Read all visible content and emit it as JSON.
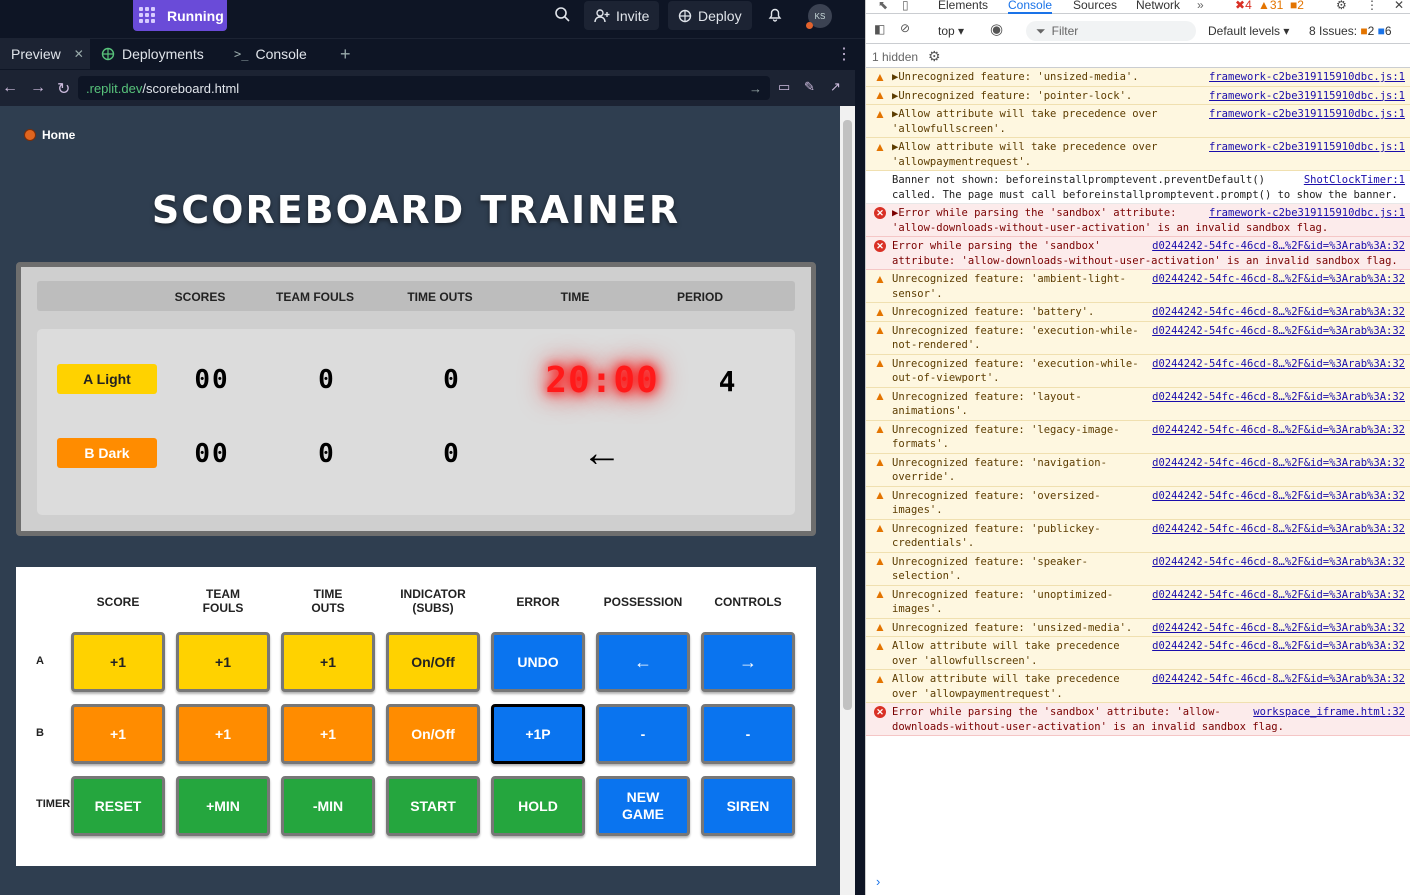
{
  "topbar": {
    "run_label": "Running",
    "invite_label": "Invite",
    "deploy_label": "Deploy",
    "avatar_initials": "KS"
  },
  "tabs": [
    {
      "label": "Preview"
    },
    {
      "label": "Deployments"
    },
    {
      "label": "Console"
    }
  ],
  "url": {
    "domain": ".replit.dev",
    "path": "/scoreboard.html"
  },
  "page": {
    "home_label": "Home",
    "title": "SCOREBOARD TRAINER"
  },
  "scoreboard": {
    "headers": [
      "SCORES",
      "TEAM FOULS",
      "TIME OUTS",
      "TIME",
      "PERIOD"
    ],
    "team_a": {
      "name": "A Light",
      "score": "00",
      "fouls": "0",
      "timeouts": "0"
    },
    "team_b": {
      "name": "B Dark",
      "score": "00",
      "fouls": "0",
      "timeouts": "0"
    },
    "time": "20:00",
    "period": "4",
    "possession_arrow": "←"
  },
  "controls": {
    "headers": [
      "SCORE",
      "TEAM\nFOULS",
      "TIME\nOUTS",
      "INDICATOR\n(SUBS)",
      "ERROR",
      "POSSESSION",
      "CONTROLS"
    ],
    "rows": [
      {
        "label": "A",
        "buttons": [
          "+1",
          "+1",
          "+1",
          "On/Off",
          "UNDO",
          "←",
          "→"
        ]
      },
      {
        "label": "B",
        "buttons": [
          "+1",
          "+1",
          "+1",
          "On/Off",
          "+1P",
          "-",
          "-"
        ]
      },
      {
        "label": "TIMER",
        "buttons": [
          "RESET",
          "+MIN",
          "-MIN",
          "START",
          "HOLD",
          "NEW\nGAME",
          "SIREN"
        ]
      }
    ]
  },
  "devtools": {
    "tabs": [
      "Elements",
      "Console",
      "Sources",
      "Network"
    ],
    "badges": {
      "errors": "4",
      "warnings": "31",
      "info": "2"
    },
    "context": "top",
    "filter_placeholder": "Filter",
    "levels": "Default levels",
    "issues": "8 Issues:",
    "issues_warn": "2",
    "issues_info": "6",
    "hidden": "1 hidden",
    "logs": [
      {
        "level": "warn",
        "msg": "▶Unrecognized feature: 'unsized-media'.",
        "src": "framework-c2be319115910dbc.js:1"
      },
      {
        "level": "warn",
        "msg": "▶Unrecognized feature: 'pointer-lock'.",
        "src": "framework-c2be319115910dbc.js:1"
      },
      {
        "level": "warn",
        "msg": "▶Allow attribute will take precedence over 'allowfullscreen'.",
        "src": "framework-c2be319115910dbc.js:1"
      },
      {
        "level": "warn",
        "msg": "▶Allow attribute will take precedence over 'allowpaymentrequest'.",
        "src": "framework-c2be319115910dbc.js:1"
      },
      {
        "level": "info",
        "msg": "Banner not shown: beforeinstallpromptevent.preventDefault() called. The page must call beforeinstallpromptevent.prompt() to show the banner.",
        "src": "ShotClockTimer:1"
      },
      {
        "level": "err",
        "msg": "▶Error while parsing the 'sandbox' attribute: 'allow-downloads-without-user-activation' is an invalid sandbox flag.",
        "src": "framework-c2be319115910dbc.js:1"
      },
      {
        "level": "err",
        "msg": "Error while parsing the 'sandbox' attribute: 'allow-downloads-without-user-activation' is an invalid sandbox flag.",
        "src": "d0244242-54fc-46cd-8…%2F&id=%3Arab%3A:32"
      },
      {
        "level": "warn",
        "msg": "Unrecognized feature: 'ambient-light-sensor'.",
        "src": "d0244242-54fc-46cd-8…%2F&id=%3Arab%3A:32"
      },
      {
        "level": "warn",
        "msg": "Unrecognized feature: 'battery'.",
        "src": "d0244242-54fc-46cd-8…%2F&id=%3Arab%3A:32"
      },
      {
        "level": "warn",
        "msg": "Unrecognized feature: 'execution-while-not-rendered'.",
        "src": "d0244242-54fc-46cd-8…%2F&id=%3Arab%3A:32"
      },
      {
        "level": "warn",
        "msg": "Unrecognized feature: 'execution-while-out-of-viewport'.",
        "src": "d0244242-54fc-46cd-8…%2F&id=%3Arab%3A:32"
      },
      {
        "level": "warn",
        "msg": "Unrecognized feature: 'layout-animations'.",
        "src": "d0244242-54fc-46cd-8…%2F&id=%3Arab%3A:32"
      },
      {
        "level": "warn",
        "msg": "Unrecognized feature: 'legacy-image-formats'.",
        "src": "d0244242-54fc-46cd-8…%2F&id=%3Arab%3A:32"
      },
      {
        "level": "warn",
        "msg": "Unrecognized feature: 'navigation-override'.",
        "src": "d0244242-54fc-46cd-8…%2F&id=%3Arab%3A:32"
      },
      {
        "level": "warn",
        "msg": "Unrecognized feature: 'oversized-images'.",
        "src": "d0244242-54fc-46cd-8…%2F&id=%3Arab%3A:32"
      },
      {
        "level": "warn",
        "msg": "Unrecognized feature: 'publickey-credentials'.",
        "src": "d0244242-54fc-46cd-8…%2F&id=%3Arab%3A:32"
      },
      {
        "level": "warn",
        "msg": "Unrecognized feature: 'speaker-selection'.",
        "src": "d0244242-54fc-46cd-8…%2F&id=%3Arab%3A:32"
      },
      {
        "level": "warn",
        "msg": "Unrecognized feature: 'unoptimized-images'.",
        "src": "d0244242-54fc-46cd-8…%2F&id=%3Arab%3A:32"
      },
      {
        "level": "warn",
        "msg": "Unrecognized feature: 'unsized-media'.",
        "src": "d0244242-54fc-46cd-8…%2F&id=%3Arab%3A:32"
      },
      {
        "level": "warn",
        "msg": "Allow attribute will take precedence over 'allowfullscreen'.",
        "src": "d0244242-54fc-46cd-8…%2F&id=%3Arab%3A:32"
      },
      {
        "level": "warn",
        "msg": "Allow attribute will take precedence over 'allowpaymentrequest'.",
        "src": "d0244242-54fc-46cd-8…%2F&id=%3Arab%3A:32"
      },
      {
        "level": "err",
        "msg": "Error while parsing the 'sandbox' attribute: 'allow-downloads-without-user-activation' is an invalid sandbox flag.",
        "src": "workspace_iframe.html:32"
      }
    ]
  },
  "colors": {
    "accent_run": "#6a4bd8",
    "team_a": "#ffd200",
    "team_b": "#ff8c00",
    "blue": "#0a74ef",
    "green": "#25a63e",
    "clock": "#ff1a1a"
  }
}
